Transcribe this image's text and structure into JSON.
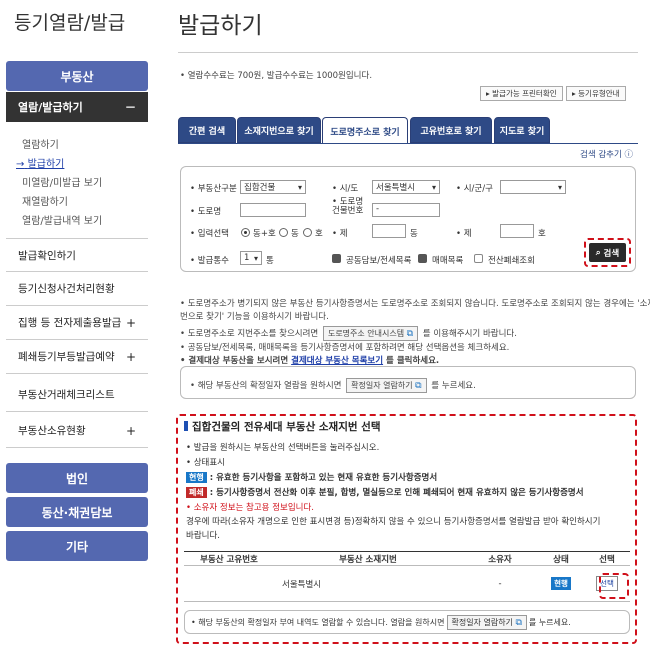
{
  "sidebar": {
    "title": "등기열람/발급",
    "real_estate": "부동산",
    "active_section": "열람/발급하기",
    "active_toggle": "－",
    "sub_items": [
      "열람하기",
      "발급하기",
      "미열람/미발급 보기",
      "재열람하기",
      "열람/발급내역 보기"
    ],
    "current_marker": "→",
    "links": [
      "발급확인하기",
      "등기신청사건처리현황",
      "집행 등 전자제출용발급",
      "폐쇄등기부등발급예약",
      "부동산거래체크리스트",
      "부동산소유현황"
    ],
    "plus": "+",
    "bottom_buttons": [
      "법인",
      "동산·채권담보",
      "기타"
    ]
  },
  "main": {
    "title": "발급하기",
    "fee_note": "• 열람수수료는 700원, 발급수수료는 1000원입니다.",
    "btn_issuable": "▸ 발급가능 프린터확인",
    "btn_type_guide": "▸ 등기유형안내",
    "tabs": [
      "간편 검색",
      "소재지번으로 찾기",
      "도로명주소로 찾기",
      "고유번호로 찾기",
      "지도로 찾기"
    ],
    "collapse": "검색 감추기 ⓘ",
    "form": {
      "type_label": "• 부동산구분",
      "type_value": "집합건물",
      "sido_label": "• 시/도",
      "sido_value": "서울특별시",
      "sigungu_label": "• 시/군/구",
      "road_label": "• 도로명",
      "bldg_no_label": "• 도로명\n건물번호",
      "bldg_no_dash": "-",
      "input_label": "• 입력선택",
      "radio_1": "동+호",
      "radio_2": "동",
      "radio_3": "호",
      "dong_prefix": "• 제",
      "dong_suffix": "동",
      "ho_prefix": "• 제",
      "ho_suffix": "호",
      "count_label": "• 발급통수",
      "count_value": "1",
      "count_unit": "통",
      "chk_joint": "공동담보/전세목록",
      "chk_trade": "매매목록",
      "chk_closed": "전산폐쇄조회",
      "search_btn": "검색",
      "search_icon": "search-icon"
    },
    "guides": [
      "• 도로명주소가 병기되지 않은 부동산 등기사항증명서는 도로명주소로 조회되지 않습니다. 도로명주소로 조회되지 않는 경우에는 '소재지",
      "  번으로 찾기' 기능을 이용하시기 바랍니다.",
      "• 도로명주소로 지번주소를 찾으시려면",
      "를 이용해주시기 바랍니다.",
      "• 공동담보/전세목록, 매매목록을 등기사항증명서에 포함하려면 해당 선택옵션을 체크하세요.",
      "• 결제대상 부동산을 보시려면",
      "결제대상 부동산 목록보기",
      "를 클릭하세요."
    ],
    "road_btn": "도로명주소 안내시스템",
    "info_text_1": "• 해당 부동산의 확정일자 열람을 원하시면",
    "info_btn": "확정일자 열람하기",
    "info_text_2": "를 누르세요."
  },
  "result": {
    "title": "집합건물의 전유세대 부동산 소재지번 선택",
    "line1": "• 발급을 원하시는 부동산의 선택버튼을 눌러주십시오.",
    "line2": "• 상태표시",
    "tag_current": "현행",
    "line3": ": 유효한 등기사항을 포함하고 있는 현재 유효한 등기사항증명서",
    "tag_closed": "폐쇄",
    "line4": ": 등기사항증명서 전산화 이후 분필, 합병, 멸실등으로 인해 폐쇄되어 현재 유효하지 않은 등기사항증명서",
    "line5": "• 소유자 정보는 참고용 정보입니다.",
    "line6": "  경우에 따라(소유자 개명으로 인한 표시변경 등)정확하지 않을 수 있으니 등기사항증명서를 열람발급 받아 확인하시기",
    "line7": "  바랍니다.",
    "columns": [
      "부동산 고유번호",
      "부동산 소재지번",
      "소유자",
      "상태",
      "선택"
    ],
    "row": {
      "id": "",
      "address": "서울특별시",
      "owner": "-",
      "status": "현행",
      "select": "선택"
    },
    "bottom_text_1": "• 해당 부동산의 확정일자 부여 내역도 열람할 수 있습니다. 열람을 원하시면",
    "bottom_btn": "확정일자 열람하기",
    "bottom_text_2": "를 누르세요."
  }
}
